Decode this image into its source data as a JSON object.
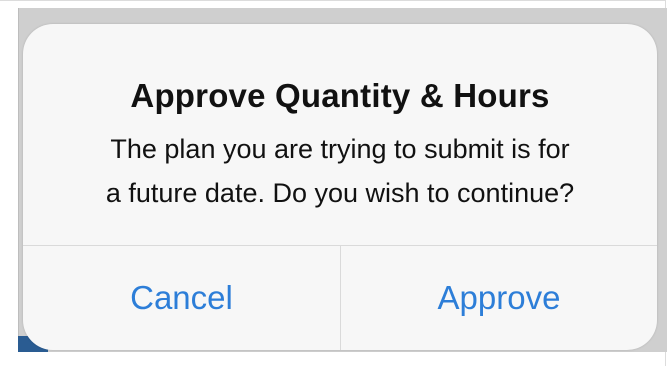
{
  "alert": {
    "title": "Approve Quantity & Hours",
    "message_line_1": "The plan you are trying to submit is for",
    "message_line_2": "a future date. Do you wish to continue?",
    "buttons": {
      "cancel_label": "Cancel",
      "approve_label": "Approve"
    }
  },
  "colors": {
    "button_text": "#2d7ed8",
    "alert_background": "#f7f7f7",
    "title_text": "#111111"
  }
}
